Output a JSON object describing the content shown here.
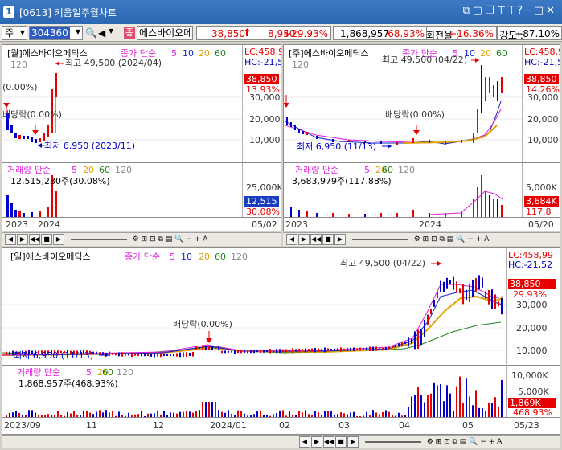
{
  "window": {
    "badge": "1",
    "title": "[0613] 키움일주월차트"
  },
  "toolbar": {
    "market": "주",
    "code": "304360",
    "stock_icon": "종",
    "stock_name": "에스바이오메",
    "price": "38,850",
    "change": "8,950",
    "change_pct": "+29.93%",
    "volume": "1,868,957",
    "volume_pct": "68.93%",
    "turnover_label": "회전율 :",
    "turnover": "+16.36%",
    "strength_label": "강도 :",
    "strength": "+87.10%"
  },
  "colors": {
    "up": "#e60000",
    "down": "#0000cc",
    "ma5": "#e020e0",
    "ma10": "#1020c0",
    "ma20": "#e0a000",
    "ma60": "#208020",
    "ma120": "#888888",
    "accent_box": "#cc0000"
  },
  "monthly": {
    "title": "[월]에스바이오메딕스",
    "ma_label": "종가 단순",
    "ma": [
      "5",
      "10",
      "20",
      "60"
    ],
    "ma120": "120",
    "left_pct": "(0.00%)",
    "dividend": "배당락(0.00%)",
    "high": "최고 49,500 (2024/04)",
    "low": "최저 6,950 (2023/11)",
    "lc": "LC:458,9",
    "hc": "HC:-21,5",
    "y_ticks": [
      "30,000",
      "20,000",
      "10,000"
    ],
    "price_tag": "38,850",
    "pct_tag": "13.93%",
    "vol_title": "거래량 단순",
    "vol_ma": [
      "5",
      "20",
      "60"
    ],
    "vol_ma120": "120",
    "vol_value": "12,515,230주(30.08%)",
    "vol_ticks": [
      "25,000K"
    ],
    "vol_tag": "12,515",
    "vol_pct_tag": "30.08%",
    "x_labels": [
      "2023",
      "2024"
    ],
    "date_right": "05/02"
  },
  "weekly": {
    "title": "[주]에스바이오메딕스",
    "ma_label": "종가 단순",
    "ma": [
      "5",
      "10",
      "20",
      "60"
    ],
    "ma120": "120",
    "dividend": "배당락(0.00%)",
    "high": "최고 49,500 (04/22)",
    "low": "최저 6,950 (11/13)",
    "lc": "LC:458,9",
    "hc": "HC:-21,5",
    "y_ticks": [
      "30,000",
      "20,000",
      "10,000"
    ],
    "price_tag": "38,850",
    "pct_tag": "14.26%",
    "vol_title": "거래량 단순",
    "vol_ma": [
      "5",
      "20",
      "60"
    ],
    "vol_ma120": "120",
    "vol_value": "3,683,979주(117.88%)",
    "vol_ticks": [
      "5,000K"
    ],
    "vol_tag": "3,684K",
    "vol_pct_tag": "117.8",
    "x_labels": [
      "2023",
      "2024"
    ],
    "date_right": "05/20"
  },
  "daily": {
    "title": "[일]에스바이오메딕스",
    "ma_label": "종가 단순",
    "ma": [
      "5",
      "10",
      "20",
      "60"
    ],
    "ma120": "120",
    "dividend": "배당락(0.00%)",
    "high": "최고 49,500 (04/22)",
    "low": "최저 6,950 (11/13)",
    "lc": "LC:458,99",
    "hc": "HC:-21,52",
    "y_ticks": [
      "30,000",
      "20,000",
      "10,000"
    ],
    "price_tag": "38,850",
    "pct_tag": "29.93%",
    "vol_title": "거래량 단순",
    "vol_ma": [
      "5",
      "20",
      "60"
    ],
    "vol_ma120": "120",
    "vol_value": "1,868,957주(468.93%)",
    "vol_ticks": [
      "10,000K",
      "5,000K"
    ],
    "vol_tag": "1,869K",
    "vol_pct_tag": "468.93%",
    "x_labels": [
      "2023/09",
      "11",
      "12",
      "2024/01",
      "02",
      "03",
      "04",
      "05"
    ],
    "date_right": "05/23"
  }
}
